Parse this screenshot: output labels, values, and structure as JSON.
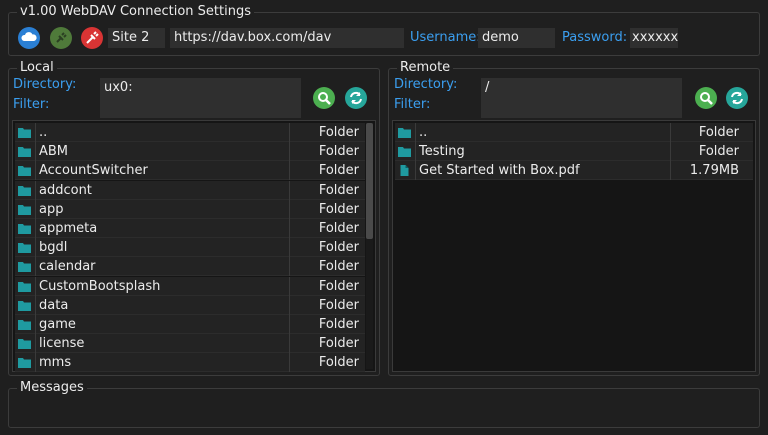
{
  "settings": {
    "title": "v1.00 WebDAV Connection Settings",
    "site": "Site 2",
    "url": "https://dav.box.com/dav",
    "username_label": "Username:",
    "username": "demo",
    "password_label": "Password:",
    "password": "xxxxxxx"
  },
  "local": {
    "title": "Local",
    "directory_label": "Directory:",
    "directory": "ux0:",
    "filter_label": "Filter:",
    "filter": "",
    "files": [
      {
        "name": "..",
        "size": "Folder",
        "type": "folder"
      },
      {
        "name": "ABM",
        "size": "Folder",
        "type": "folder"
      },
      {
        "name": "AccountSwitcher",
        "size": "Folder",
        "type": "folder"
      },
      {
        "name": "addcont",
        "size": "Folder",
        "type": "folder"
      },
      {
        "name": "app",
        "size": "Folder",
        "type": "folder"
      },
      {
        "name": "appmeta",
        "size": "Folder",
        "type": "folder"
      },
      {
        "name": "bgdl",
        "size": "Folder",
        "type": "folder"
      },
      {
        "name": "calendar",
        "size": "Folder",
        "type": "folder"
      },
      {
        "name": "CustomBootsplash",
        "size": "Folder",
        "type": "folder"
      },
      {
        "name": "data",
        "size": "Folder",
        "type": "folder"
      },
      {
        "name": "game",
        "size": "Folder",
        "type": "folder"
      },
      {
        "name": "license",
        "size": "Folder",
        "type": "folder"
      },
      {
        "name": "mms",
        "size": "Folder",
        "type": "folder"
      }
    ]
  },
  "remote": {
    "title": "Remote",
    "directory_label": "Directory:",
    "directory": "/",
    "filter_label": "Filter:",
    "filter": "",
    "files": [
      {
        "name": "..",
        "size": "Folder",
        "type": "folder"
      },
      {
        "name": "Testing",
        "size": "Folder",
        "type": "folder"
      },
      {
        "name": "Get Started with Box.pdf",
        "size": "1.79MB",
        "type": "file"
      }
    ]
  },
  "messages": {
    "title": "Messages"
  },
  "colors": {
    "accent": "#3b9ff0",
    "folder_icon": "#1f9aa0",
    "connect_button": "#2a7fd4",
    "disconnect_button": "#4f7a3a",
    "delete_button": "#d93434",
    "search_button": "#4caf50",
    "refresh_button": "#26a69a"
  }
}
